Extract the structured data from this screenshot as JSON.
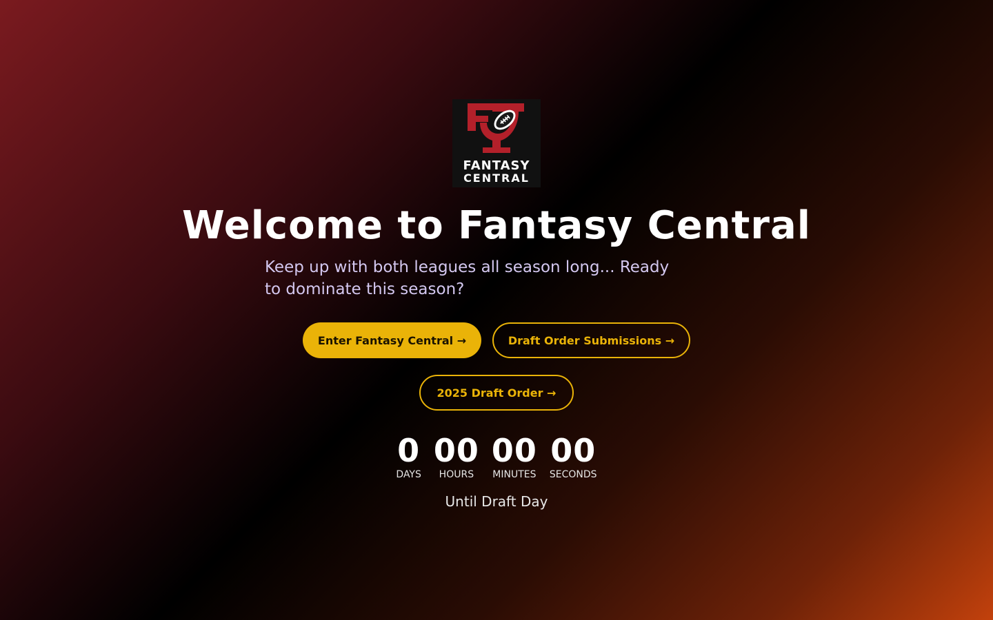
{
  "brand": {
    "logo_line1": "FANTASY",
    "logo_line2": "CENTRAL",
    "logo_color": "#b3202a",
    "logo_bg": "#111111"
  },
  "hero": {
    "title": "Welcome to Fantasy Central",
    "subtitle": "Keep up with both leagues all season long... Ready to dominate this season?"
  },
  "buttons": {
    "enter": "Enter Fantasy Central →",
    "draft_submissions": "Draft Order Submissions →",
    "draft_order": "2025 Draft Order →"
  },
  "countdown": {
    "units": [
      {
        "value": "0",
        "label": "DAYS"
      },
      {
        "value": "00",
        "label": "HOURS"
      },
      {
        "value": "00",
        "label": "MINUTES"
      },
      {
        "value": "00",
        "label": "SECONDS"
      }
    ],
    "caption": "Until Draft Day"
  },
  "colors": {
    "accent": "#eab308",
    "subtitle": "#d4c8f0"
  }
}
